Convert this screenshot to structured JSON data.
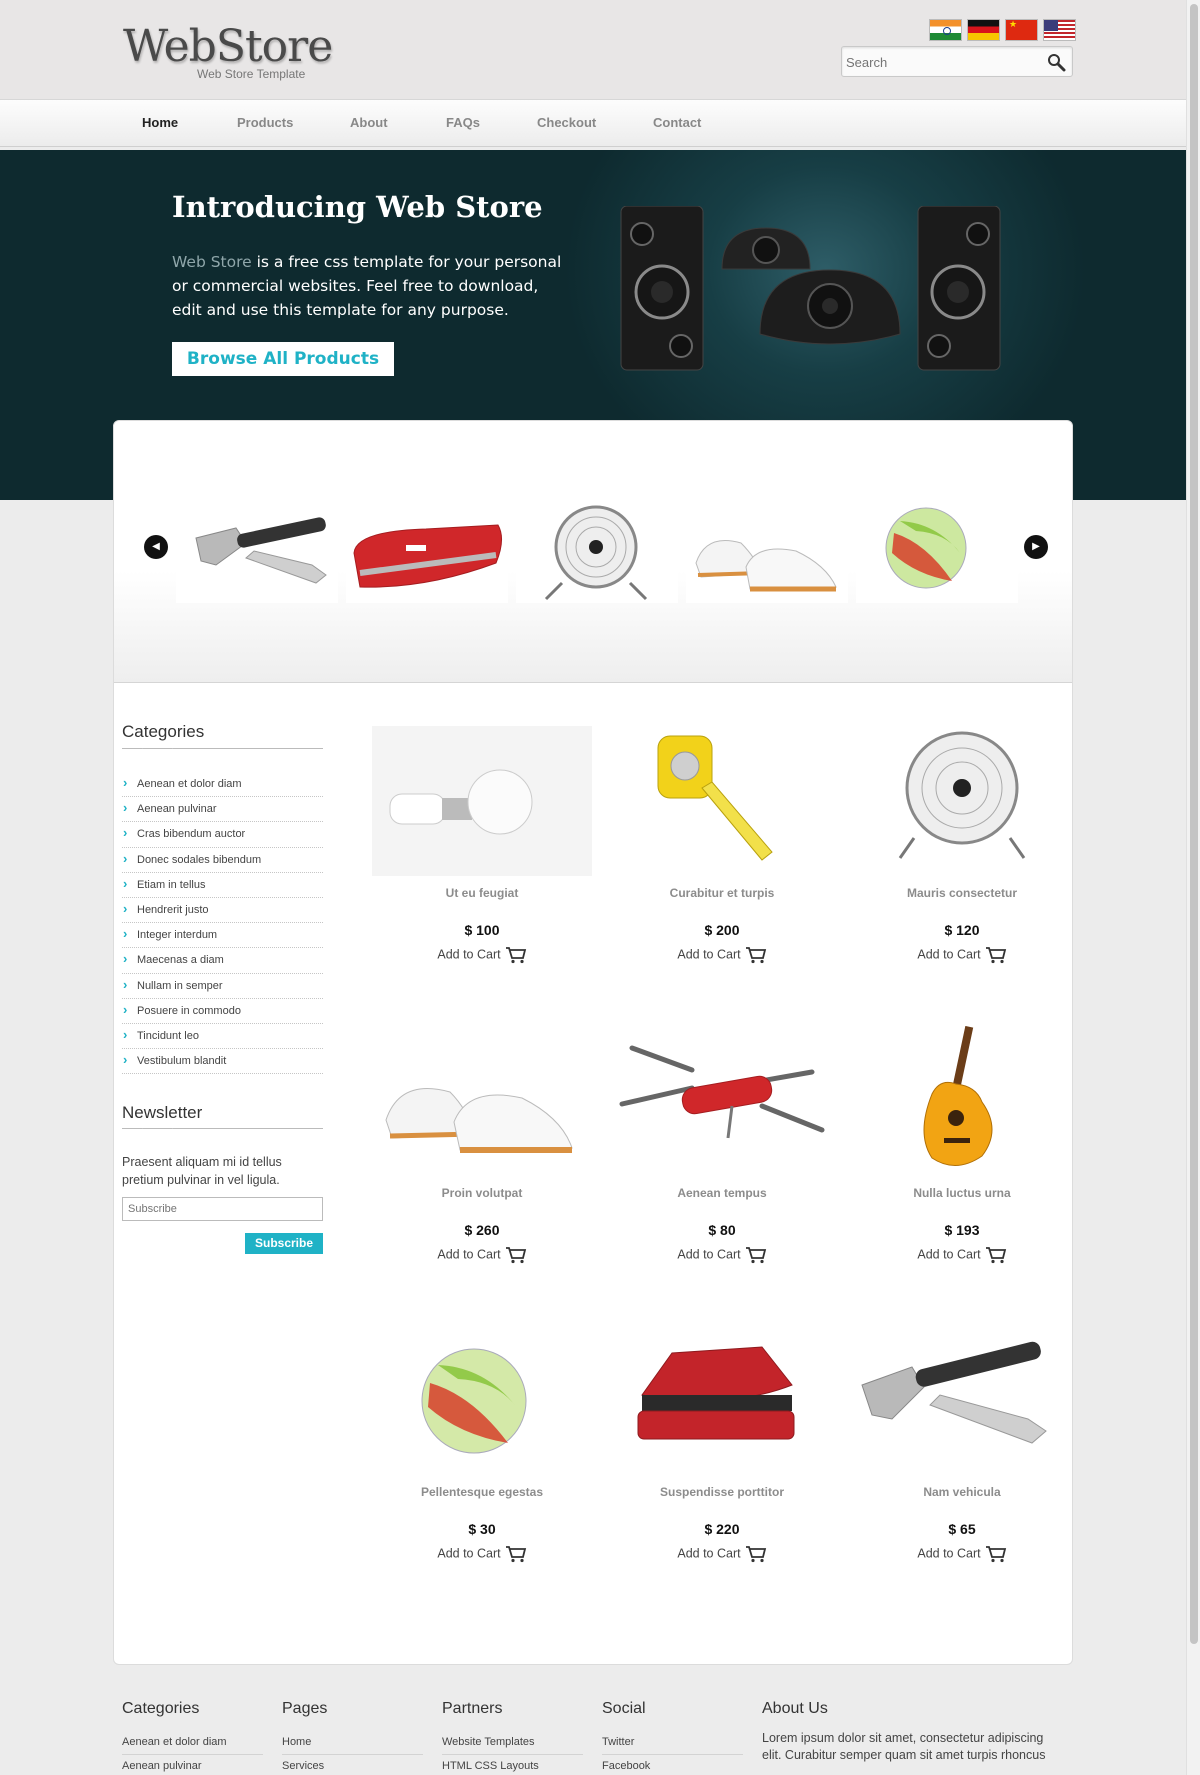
{
  "header": {
    "logo_title": "WebStore",
    "logo_subtitle": "Web Store Template",
    "flags": [
      "india-flag-icon",
      "germany-flag-icon",
      "china-flag-icon",
      "usa-flag-icon"
    ],
    "search_placeholder": "Search"
  },
  "nav": {
    "items": [
      "Home",
      "Products",
      "About",
      "FAQs",
      "Checkout",
      "Contact"
    ],
    "active": "Home"
  },
  "hero": {
    "title": "Introducing Web Store",
    "highlight": "Web Store",
    "text": " is a free css template for your personal or commercial websites. Feel free to download, edit and use this template for any purpose.",
    "button": "Browse All Products"
  },
  "sidebar": {
    "categories_title": "Categories",
    "categories": [
      "Aenean et dolor diam",
      "Aenean pulvinar",
      "Cras bibendum auctor",
      "Donec sodales bibendum",
      "Etiam in tellus",
      "Hendrerit justo",
      "Integer interdum",
      "Maecenas a diam",
      "Nullam in semper",
      "Posuere in commodo",
      "Tincidunt leo",
      "Vestibulum blandit"
    ],
    "newsletter_title": "Newsletter",
    "newsletter_text": "Praesent aliquam mi id tellus pretium pulvinar in vel ligula.",
    "subscribe_placeholder": "Subscribe",
    "subscribe_button": "Subscribe"
  },
  "products": [
    {
      "name": "Ut eu feugiat",
      "price": "$ 100",
      "cart": "Add to Cart"
    },
    {
      "name": "Curabitur et turpis",
      "price": "$ 200",
      "cart": "Add to Cart"
    },
    {
      "name": "Mauris consectetur",
      "price": "$ 120",
      "cart": "Add to Cart"
    },
    {
      "name": "Proin volutpat",
      "price": "$ 260",
      "cart": "Add to Cart"
    },
    {
      "name": "Aenean tempus",
      "price": "$ 80",
      "cart": "Add to Cart"
    },
    {
      "name": "Nulla luctus urna",
      "price": "$ 193",
      "cart": "Add to Cart"
    },
    {
      "name": "Pellentesque egestas",
      "price": "$ 30",
      "cart": "Add to Cart"
    },
    {
      "name": "Suspendisse porttitor",
      "price": "$ 220",
      "cart": "Add to Cart"
    },
    {
      "name": "Nam vehicula",
      "price": "$ 65",
      "cart": "Add to Cart"
    }
  ],
  "footer": {
    "categories_title": "Categories",
    "categories": [
      "Aenean et dolor diam",
      "Aenean pulvinar"
    ],
    "pages_title": "Pages",
    "pages": [
      "Home",
      "Services"
    ],
    "partners_title": "Partners",
    "partners": [
      "Website Templates",
      "HTML CSS Layouts"
    ],
    "social_title": "Social",
    "social": [
      "Twitter",
      "Facebook"
    ],
    "about_title": "About Us",
    "about_text": "Lorem ipsum dolor sit amet, consectetur adipiscing elit. Curabitur semper quam sit amet turpis rhoncus"
  }
}
